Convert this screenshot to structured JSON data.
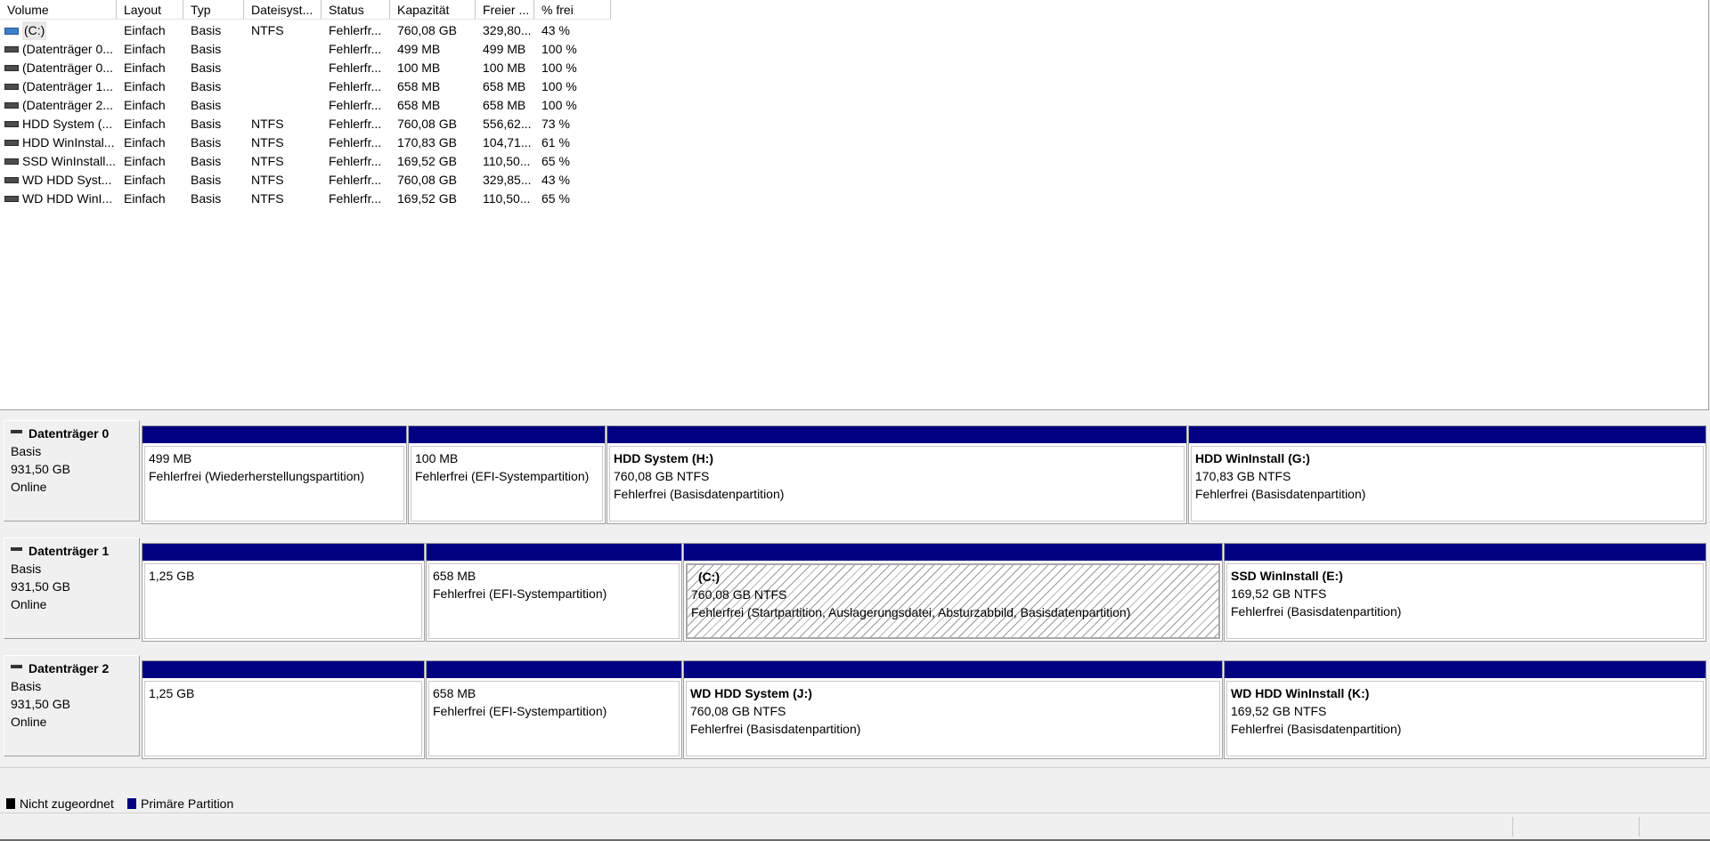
{
  "columns": [
    "Volume",
    "Layout",
    "Typ",
    "Dateisyst...",
    "Status",
    "Kapazität",
    "Freier ...",
    "% frei"
  ],
  "volumes": [
    {
      "name": "(C:)",
      "layout": "Einfach",
      "typ": "Basis",
      "fs": "NTFS",
      "status": "Fehlerfr...",
      "kapazitaet": "760,08 GB",
      "frei": "329,80...",
      "prozent": "43 %"
    },
    {
      "name": "(Datenträger 0...",
      "layout": "Einfach",
      "typ": "Basis",
      "fs": "",
      "status": "Fehlerfr...",
      "kapazitaet": "499 MB",
      "frei": "499 MB",
      "prozent": "100 %"
    },
    {
      "name": "(Datenträger 0...",
      "layout": "Einfach",
      "typ": "Basis",
      "fs": "",
      "status": "Fehlerfr...",
      "kapazitaet": "100 MB",
      "frei": "100 MB",
      "prozent": "100 %"
    },
    {
      "name": "(Datenträger 1...",
      "layout": "Einfach",
      "typ": "Basis",
      "fs": "",
      "status": "Fehlerfr...",
      "kapazitaet": "658 MB",
      "frei": "658 MB",
      "prozent": "100 %"
    },
    {
      "name": "(Datenträger 2...",
      "layout": "Einfach",
      "typ": "Basis",
      "fs": "",
      "status": "Fehlerfr...",
      "kapazitaet": "658 MB",
      "frei": "658 MB",
      "prozent": "100 %"
    },
    {
      "name": "HDD System (...",
      "layout": "Einfach",
      "typ": "Basis",
      "fs": "NTFS",
      "status": "Fehlerfr...",
      "kapazitaet": "760,08 GB",
      "frei": "556,62...",
      "prozent": "73 %"
    },
    {
      "name": "HDD WinInstal...",
      "layout": "Einfach",
      "typ": "Basis",
      "fs": "NTFS",
      "status": "Fehlerfr...",
      "kapazitaet": "170,83 GB",
      "frei": "104,71...",
      "prozent": "61 %"
    },
    {
      "name": "SSD WinInstall...",
      "layout": "Einfach",
      "typ": "Basis",
      "fs": "NTFS",
      "status": "Fehlerfr...",
      "kapazitaet": "169,52 GB",
      "frei": "110,50...",
      "prozent": "65 %"
    },
    {
      "name": "WD HDD Syst...",
      "layout": "Einfach",
      "typ": "Basis",
      "fs": "NTFS",
      "status": "Fehlerfr...",
      "kapazitaet": "760,08 GB",
      "frei": "329,85...",
      "prozent": "43 %"
    },
    {
      "name": "WD HDD WinI...",
      "layout": "Einfach",
      "typ": "Basis",
      "fs": "NTFS",
      "status": "Fehlerfr...",
      "kapazitaet": "169,52 GB",
      "frei": "110,50...",
      "prozent": "65 %"
    }
  ],
  "disks": [
    {
      "name": "Datenträger 0",
      "type": "Basis",
      "size": "931,50 GB",
      "state": "Online",
      "partitions": [
        {
          "name": "",
          "size": "499 MB",
          "status": "Fehlerfrei (Wiederherstellungspartition)"
        },
        {
          "name": "",
          "size": "100 MB",
          "status": "Fehlerfrei (EFI-Systempartition)"
        },
        {
          "name": "HDD System  (H:)",
          "size": "760,08 GB NTFS",
          "status": "Fehlerfrei (Basisdatenpartition)"
        },
        {
          "name": "HDD WinInstall  (G:)",
          "size": "170,83 GB NTFS",
          "status": "Fehlerfrei (Basisdatenpartition)"
        }
      ]
    },
    {
      "name": "Datenträger 1",
      "type": "Basis",
      "size": "931,50 GB",
      "state": "Online",
      "partitions": [
        {
          "name": "",
          "size": "1,25 GB",
          "status": ""
        },
        {
          "name": "",
          "size": "658 MB",
          "status": "Fehlerfrei (EFI-Systempartition)"
        },
        {
          "name": "(C:)",
          "size": "760,08 GB NTFS",
          "status": "Fehlerfrei (Startpartition, Auslagerungsdatei, Absturzabbild, Basisdatenpartition)"
        },
        {
          "name": "SSD WinInstall  (E:)",
          "size": "169,52 GB NTFS",
          "status": "Fehlerfrei (Basisdatenpartition)"
        }
      ]
    },
    {
      "name": "Datenträger 2",
      "type": "Basis",
      "size": "931,50 GB",
      "state": "Online",
      "partitions": [
        {
          "name": "",
          "size": "1,25 GB",
          "status": ""
        },
        {
          "name": "",
          "size": "658 MB",
          "status": "Fehlerfrei (EFI-Systempartition)"
        },
        {
          "name": "WD HDD System  (J:)",
          "size": "760,08 GB NTFS",
          "status": "Fehlerfrei (Basisdatenpartition)"
        },
        {
          "name": "WD HDD WinInstall  (K:)",
          "size": "169,52 GB NTFS",
          "status": "Fehlerfrei (Basisdatenpartition)"
        }
      ]
    }
  ],
  "legend": {
    "unallocated": "Nicht zugeordnet",
    "primary": "Primäre Partition"
  },
  "colors": {
    "primary": "#000080",
    "unallocated": "#000000",
    "system_volume_icon": "#3a7fc9"
  }
}
